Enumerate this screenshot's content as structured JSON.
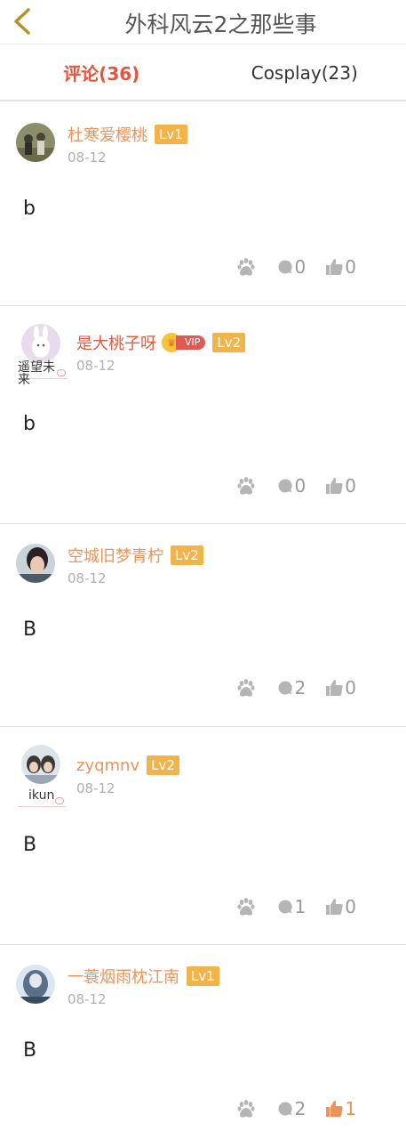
{
  "header": {
    "title": "外科风云2之那些事"
  },
  "tabs": [
    {
      "label": "评论(36)",
      "active": true
    },
    {
      "label": "Cosplay(23)",
      "active": false
    }
  ],
  "colors": {
    "accent": "#e5563e",
    "name": "#e8945a",
    "level": "#f2b34a",
    "liked": "#e8945a"
  },
  "comments": [
    {
      "name": "杜寒爱樱桃",
      "level": "Lv1",
      "date": "08-12",
      "text": "b",
      "replies": "0",
      "likes": "0",
      "badge": ""
    },
    {
      "name": "是大桃子呀",
      "level": "Lv2",
      "vip": "VIP",
      "date": "08-12",
      "text": "b",
      "replies": "0",
      "likes": "0",
      "badge": "遥望未来"
    },
    {
      "name": "空城旧梦青柠",
      "level": "Lv2",
      "date": "08-12",
      "text": "B",
      "replies": "2",
      "likes": "0",
      "badge": ""
    },
    {
      "name": "zyqmnv",
      "level": "Lv2",
      "date": "08-12",
      "text": "B",
      "replies": "1",
      "likes": "0",
      "badge": "ikun"
    },
    {
      "name": "一蓑烟雨枕江南",
      "level": "Lv1",
      "date": "08-12",
      "text": "B",
      "replies": "2",
      "likes": "1",
      "badge": ""
    }
  ]
}
